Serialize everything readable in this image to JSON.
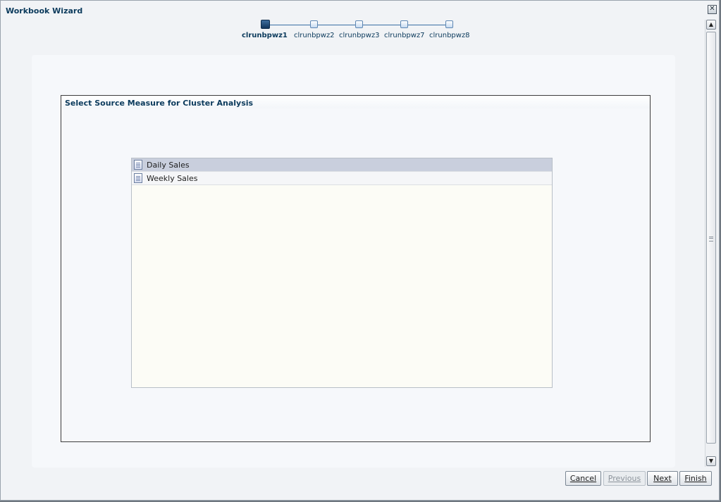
{
  "dialog": {
    "title": "Workbook Wizard"
  },
  "train": {
    "steps": [
      {
        "label": "clrunbpwz1",
        "active": true
      },
      {
        "label": "clrunbpwz2",
        "active": false
      },
      {
        "label": "clrunbpwz3",
        "active": false
      },
      {
        "label": "clrunbpwz7",
        "active": false
      },
      {
        "label": "clrunbpwz8",
        "active": false
      }
    ]
  },
  "section": {
    "title": "Select Source Measure for Cluster Analysis"
  },
  "measures": [
    {
      "label": "Daily Sales",
      "selected": true
    },
    {
      "label": "Weekly Sales",
      "selected": false
    }
  ],
  "buttons": {
    "cancel": "Cancel",
    "previous": "Previous",
    "next": "Next",
    "finish": "Finish"
  },
  "icons": {
    "close": "close-icon",
    "measure": "measure-document-icon",
    "scroll_up": "scroll-up-arrow-icon",
    "scroll_down": "scroll-down-arrow-icon"
  },
  "colors": {
    "active_step": "#1f4c7a",
    "selected_row": "#c9cfdd",
    "title_text": "#0b3a5c"
  }
}
